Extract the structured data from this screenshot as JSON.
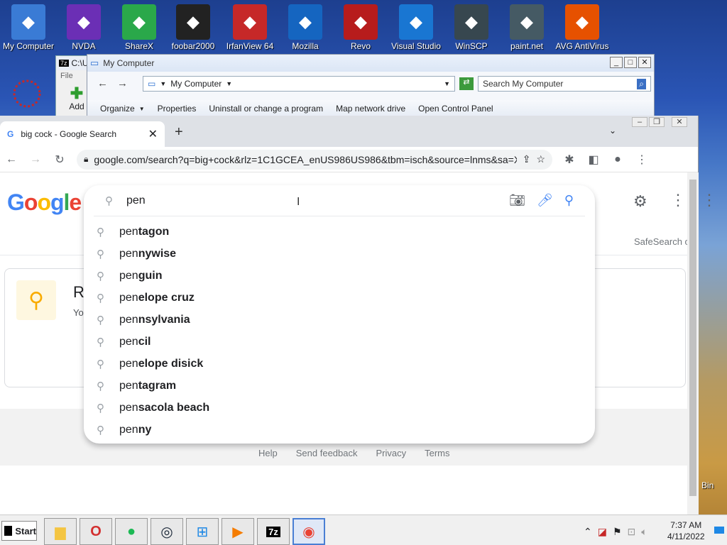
{
  "desktop": {
    "icons": [
      {
        "label": "My Computer",
        "icon": "computer-icon",
        "color": "#3a7bd5"
      },
      {
        "label": "NVDA",
        "icon": "nvda-icon",
        "color": "#6b2fb5"
      },
      {
        "label": "ShareX",
        "icon": "sharex-icon",
        "color": "#2aa84a"
      },
      {
        "label": "foobar2000",
        "icon": "foobar-icon",
        "color": "#222222"
      },
      {
        "label": "IrfanView 64",
        "icon": "irfanview-icon",
        "color": "#c62828"
      },
      {
        "label": "Mozilla",
        "icon": "thunderbird-icon",
        "color": "#1565c0"
      },
      {
        "label": "Revo",
        "icon": "revo-icon",
        "color": "#b71c1c"
      },
      {
        "label": "Visual Studio",
        "icon": "vscode-icon",
        "color": "#1976d2"
      },
      {
        "label": "WinSCP",
        "icon": "winscp-icon",
        "color": "#37474f"
      },
      {
        "label": "paint.net",
        "icon": "paintnet-icon",
        "color": "#455a64"
      },
      {
        "label": "AVG AntiVirus",
        "icon": "avg-icon",
        "color": "#e65100"
      }
    ],
    "recycle_label": "Bin"
  },
  "win7z": {
    "title": "C:\\U",
    "menu": "File",
    "add_label": "Add"
  },
  "explorer": {
    "title": "My Computer",
    "address": "My Computer",
    "search_placeholder": "Search My Computer",
    "commands": [
      "Organize",
      "Properties",
      "Uninstall or change a program",
      "Map network drive",
      "Open Control Panel"
    ]
  },
  "chrome": {
    "tab_title": "big cock - Google Search",
    "url": "google.com/search?q=big+cock&rlz=1C1GCEA_enUS986US986&tbm=isch&source=lnms&sa=X&ved...",
    "safesearch": "SafeSearch o",
    "result_title": "Re",
    "result_sub": "Yo",
    "footer_links": [
      "Help",
      "Send feedback",
      "Privacy",
      "Terms"
    ]
  },
  "search": {
    "query": "pen",
    "suggestions": [
      {
        "typed": "pen",
        "completion": "tagon"
      },
      {
        "typed": "pen",
        "completion": "nywise"
      },
      {
        "typed": "pen",
        "completion": "guin"
      },
      {
        "typed": "pen",
        "completion": "elope cruz"
      },
      {
        "typed": "pen",
        "completion": "nsylvania"
      },
      {
        "typed": "pen",
        "completion": "cil"
      },
      {
        "typed": "pen",
        "completion": "elope disick"
      },
      {
        "typed": "pen",
        "completion": "tagram"
      },
      {
        "typed": "pen",
        "completion": "sacola beach"
      },
      {
        "typed": "pen",
        "completion": "ny"
      }
    ]
  },
  "taskbar": {
    "start_label": "Start",
    "time": "7:37 AM",
    "date": "4/11/2022"
  }
}
